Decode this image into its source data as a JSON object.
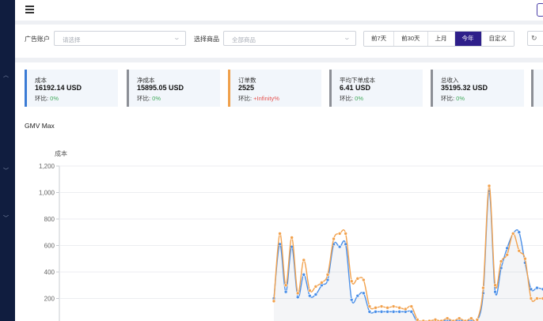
{
  "filters": {
    "account_label": "广告账户",
    "account_placeholder": "请选择",
    "product_label": "选择商品",
    "product_placeholder": "全部商品",
    "ranges": [
      "前7天",
      "前30天",
      "上月",
      "今年",
      "自定义"
    ],
    "active_range": "今年"
  },
  "metrics": [
    {
      "title": "成本",
      "value": "16192.14 USD",
      "cmp_label": "环比: ",
      "cmp_value": "0%",
      "cmp_status": "pos",
      "accent": "#3a7bd5"
    },
    {
      "title": "净成本",
      "value": "15895.05 USD",
      "cmp_label": "环比: ",
      "cmp_value": "0%",
      "cmp_status": "pos",
      "accent": "#8c8f96"
    },
    {
      "title": "订单数",
      "value": "2525",
      "cmp_label": "环比: ",
      "cmp_value": "+Infinity%",
      "cmp_status": "neg",
      "accent": "#f0a04a"
    },
    {
      "title": "平均下单成本",
      "value": "6.41 USD",
      "cmp_label": "环比: ",
      "cmp_value": "0%",
      "cmp_status": "pos",
      "accent": "#8c8f96"
    },
    {
      "title": "总收入",
      "value": "35195.32 USD",
      "cmp_label": "环比: ",
      "cmp_value": "0%",
      "cmp_status": "pos",
      "accent": "#8c8f96"
    }
  ],
  "chart_title": "GMV Max",
  "colors": {
    "series_blue": "#4a8fe8",
    "series_orange": "#f2a24e",
    "sidebar": "#101d3f",
    "active": "#2e1f8a"
  },
  "chart_data": {
    "type": "line",
    "ylabel": "成本",
    "ylim": [
      0,
      1200
    ],
    "yticks": [
      200,
      400,
      600,
      800,
      1000,
      1200
    ],
    "series": [
      {
        "values": [
          200,
          610,
          250,
          590,
          210,
          380,
          220,
          230,
          300,
          340,
          610,
          590,
          610,
          190,
          220,
          240,
          100,
          100,
          100,
          100,
          100,
          100,
          100,
          100,
          20,
          20,
          20,
          30,
          20,
          40,
          20,
          40,
          20,
          40,
          30,
          240,
          1010,
          250,
          430,
          580,
          690,
          700,
          470,
          270,
          280,
          270
        ]
      },
      {
        "values": [
          180,
          690,
          300,
          660,
          240,
          490,
          260,
          290,
          320,
          380,
          650,
          690,
          690,
          330,
          350,
          340,
          140,
          130,
          140,
          130,
          140,
          130,
          120,
          140,
          40,
          30,
          30,
          40,
          30,
          50,
          30,
          50,
          30,
          50,
          40,
          280,
          1050,
          300,
          480,
          530,
          690,
          560,
          500,
          200,
          200,
          200
        ]
      }
    ]
  }
}
